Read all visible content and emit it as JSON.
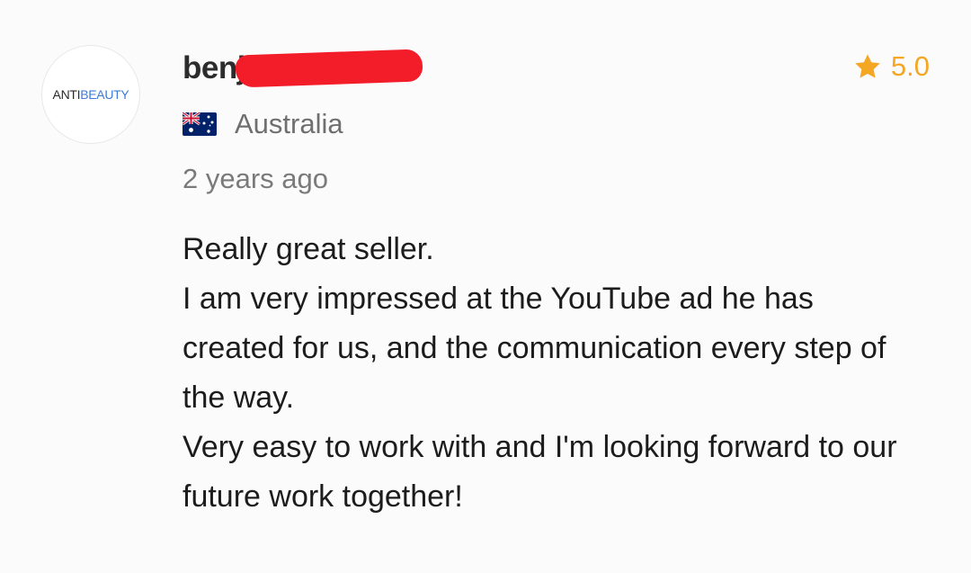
{
  "review_card": {
    "avatar": {
      "logo_text_part1": "ANTI",
      "logo_text_part2": "BEAUTY"
    },
    "reviewer": {
      "name_visible": "benj",
      "name_redacted": true
    },
    "rating": {
      "value": "5.0",
      "icon": "star-icon",
      "color": "#f5a623"
    },
    "country": {
      "flag_icon": "australia-flag-icon",
      "name": "Australia"
    },
    "time_ago": "2 years ago",
    "review_lines": [
      "Really great seller.",
      "I am very impressed at the YouTube ad he has created for us, and the communication every step of the way.",
      "Very easy to work with and I'm looking forward to our future work together!"
    ]
  }
}
